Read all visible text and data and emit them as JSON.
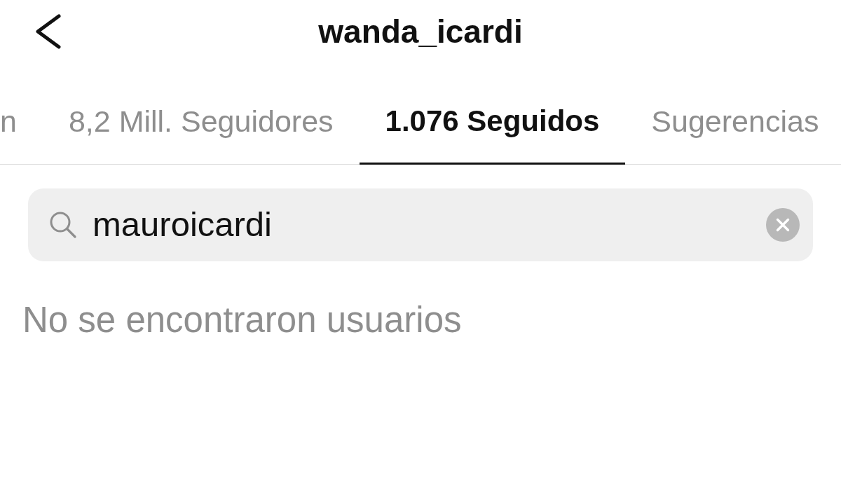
{
  "header": {
    "title": "wanda_icardi"
  },
  "tabs": [
    {
      "label": "n",
      "selected": false
    },
    {
      "label": "8,2 Mill. Seguidores",
      "selected": false
    },
    {
      "label": "1.076 Seguidos",
      "selected": true
    },
    {
      "label": "Sugerencias",
      "selected": false
    }
  ],
  "search": {
    "value": "mauroicardi"
  },
  "empty_message": "No se encontraron usuarios"
}
